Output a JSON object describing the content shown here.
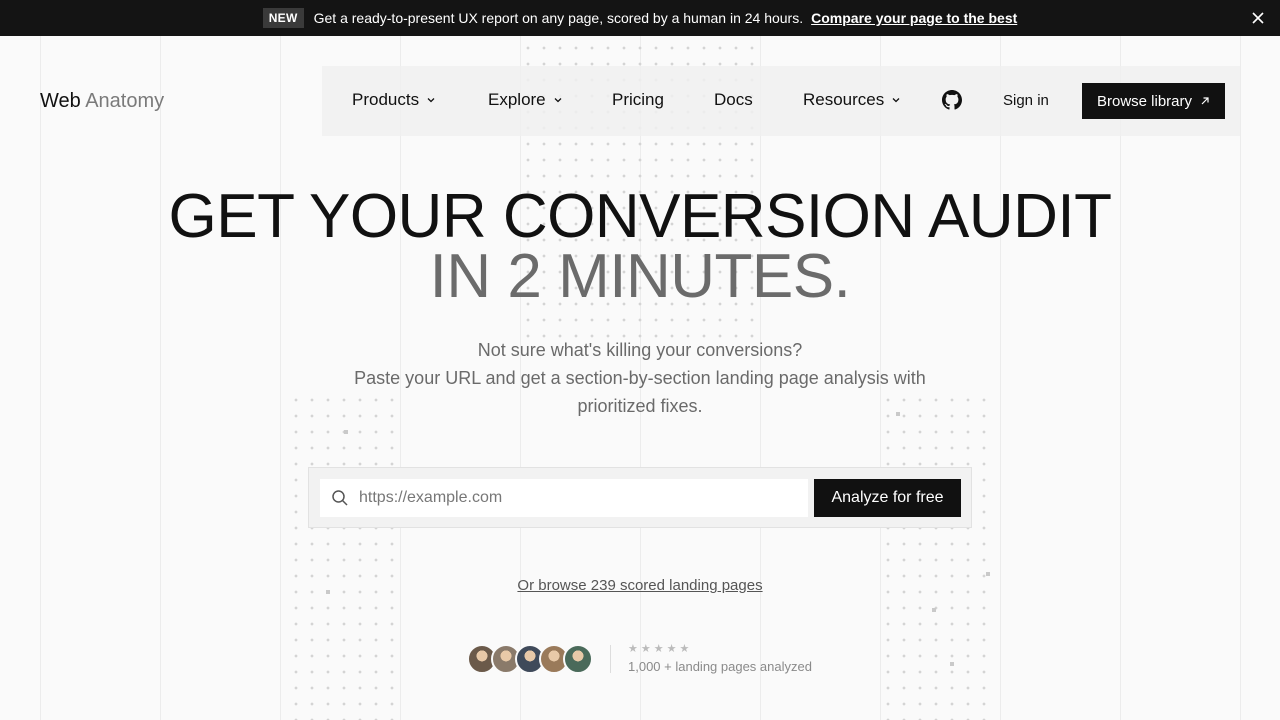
{
  "announcement": {
    "badge": "NEW",
    "text": "Get a ready-to-present UX report on any page, scored by a human in 24 hours.",
    "link": "Compare your page to the best"
  },
  "logo": {
    "primary": "Web",
    "secondary": "Anatomy"
  },
  "nav": {
    "items": [
      {
        "label": "Products",
        "dropdown": true
      },
      {
        "label": "Explore",
        "dropdown": true
      },
      {
        "label": "Pricing",
        "dropdown": false
      },
      {
        "label": "Docs",
        "dropdown": false
      },
      {
        "label": "Resources",
        "dropdown": true
      }
    ],
    "github_icon": "github-icon",
    "sign_in": "Sign in",
    "cta": "Browse library"
  },
  "hero": {
    "line1": "GET YOUR CONVERSION AUDIT",
    "line2": "IN 2 MINUTES.",
    "sub1": "Not sure what's killing your conversions?",
    "sub2": "Paste your URL and get a section-by-section landing page analysis with",
    "sub3": "prioritized fixes."
  },
  "form": {
    "placeholder": "https://example.com",
    "value": "",
    "button": "Analyze for free"
  },
  "browse_link": "Or browse 239 scored landing pages",
  "social_proof": {
    "stars": "★★★★★",
    "text": "1,000 + landing pages analyzed",
    "avatar_colors": [
      "#6b5a4a",
      "#8a7a6a",
      "#3f4a5a",
      "#9a7a5a",
      "#4a6a5a"
    ]
  },
  "colors": {
    "primary": "#111111",
    "background": "#fafafa",
    "muted": "#6b6b6b"
  }
}
